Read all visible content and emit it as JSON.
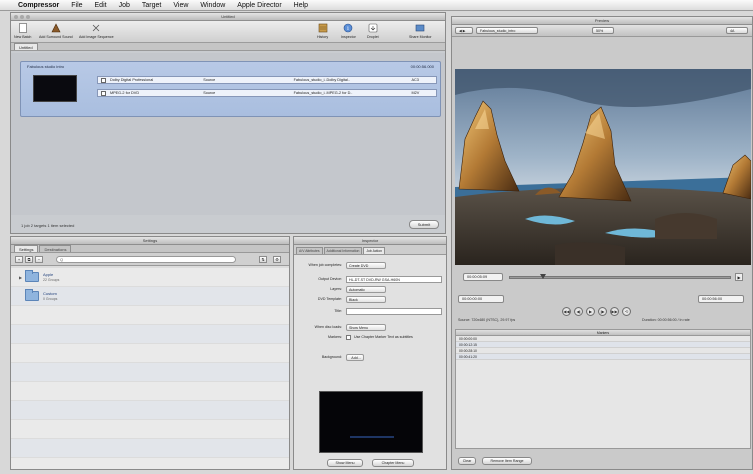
{
  "menubar": {
    "apple_glyph": "",
    "items": [
      "Compressor",
      "File",
      "Edit",
      "Job",
      "Target",
      "View",
      "Window",
      "Apple Director",
      "Help"
    ]
  },
  "batch": {
    "title": "Untitled",
    "toolbar": {
      "new_batch": "New Batch",
      "add_surround": "Add Surround Sound",
      "add_image_sequence": "Add Image Sequence",
      "history": "History",
      "inspector": "Inspector",
      "droplet": "Droplet",
      "share_monitor": "Share Monitor"
    },
    "tab": "Untitled",
    "job": {
      "name": "Fabulous studio intro",
      "duration": "00:00:56.000",
      "targets": [
        {
          "setting": "Dolby Digital Professional",
          "destination": "Source",
          "output": "Fabulous_studio_i..Dolby Digital..",
          "extra": "AC3"
        },
        {
          "setting": "MPEG-2 for DVD",
          "destination": "Source",
          "output": "Fabulous_studio_i..MPEG-2 for D..",
          "extra": "M2V"
        }
      ]
    },
    "status": "1 job 2 targets   1 item selected",
    "submit": "Submit"
  },
  "settings": {
    "title": "Settings",
    "tabs": [
      "Settings",
      "Destinations"
    ],
    "search_placeholder": "Q",
    "list": [
      {
        "name": "Apple",
        "sub": "22 Groups"
      },
      {
        "name": "Custom",
        "sub": "0 Groups"
      }
    ]
  },
  "inspector": {
    "title": "Inspector",
    "tabs": [
      "A/V Attributes",
      "Additional Information",
      "Job Action"
    ],
    "fields": {
      "when_done_label": "When job completes:",
      "when_done_value": "Create DVD",
      "output_device_label": "Output Device:",
      "output_device_value": "HL-DT-ST DVD-RW GSA-H60N",
      "layers_label": "Layers:",
      "layers_value": "Automatic",
      "dvd_template_label": "DVD Template:",
      "dvd_template_value": "Black",
      "title_label": "Title:",
      "title_value": "",
      "disc_loads_label": "When disc loads:",
      "disc_loads_value": "Show Menu",
      "markers_label": "Markers:",
      "markers_value": "Use Chapter Marker Text as subtitles",
      "background_label": "Background:",
      "background_button": "Add..."
    },
    "buttons": [
      "Show Menu",
      "Chapter Menu"
    ]
  },
  "preview": {
    "title": "Preview",
    "source_popup": "Fabulous_studio_intro",
    "zoom_popup": "50%",
    "size_popup": "4A",
    "timecode_top": "00:00:05:09",
    "timecode_in": "00:00:00:00",
    "timecode_out": "00:00:56:00",
    "timecode_right": "00:00:56:00",
    "source_info": "Source: 720x480 (NTSC), 29.97 fps",
    "duration_info": "Duration: 00:00:56:00 / In rate",
    "transport": [
      "◀◀",
      "◀|",
      "▶",
      "|▶",
      "▶▶",
      "⟲"
    ],
    "markers_title": "Markers",
    "markers": [
      "00:00:00:00",
      "00:00:12:15",
      "00:00:28:10",
      "00:00:41:20"
    ],
    "clear_button": "Clear",
    "bottom_button": "Remove Item Range"
  },
  "colors": {
    "job_highlight": "#b8c9e6",
    "menubar": "#f0f0f0",
    "window_bg": "#c9ccd0"
  }
}
